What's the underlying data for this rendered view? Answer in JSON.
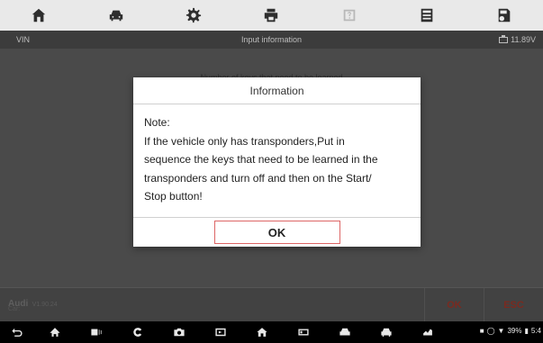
{
  "toolbar": {
    "items": [
      {
        "icon": "home-icon"
      },
      {
        "icon": "vehicle-swap-icon"
      },
      {
        "icon": "settings-gear-icon"
      },
      {
        "icon": "print-icon"
      },
      {
        "icon": "help-icon",
        "disabled": true
      },
      {
        "icon": "data-log-icon"
      },
      {
        "icon": "save-icon"
      }
    ]
  },
  "infobar": {
    "vin_label": "VIN",
    "title": "Input information",
    "voltage": "11.89V"
  },
  "main": {
    "prompt": "Number of keys that need to be learned"
  },
  "dialog": {
    "title": "Information",
    "body_lines": [
      "Note:",
      "If the vehicle only has transponders,Put in",
      "sequence the keys that need to be learned in the",
      "transponders and turn off and then on the Start/",
      "Stop button!"
    ],
    "ok_label": "OK"
  },
  "footer": {
    "make": "Audi",
    "version": "V1.90.24",
    "car_label": "Car:",
    "ok_label": "OK",
    "esc_label": "ESC"
  },
  "navbar": {
    "battery": "39%",
    "time": "5:4"
  },
  "colors": {
    "accent": "#d66666",
    "footer_button_text": "#7a2a20"
  }
}
